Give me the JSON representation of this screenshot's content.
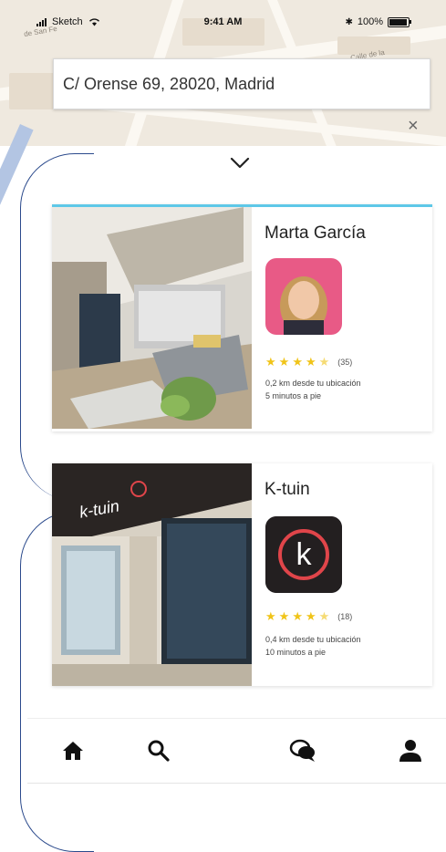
{
  "status_bar": {
    "carrier": "Sketch",
    "time": "9:41 AM",
    "battery": "100%",
    "icons": [
      "signal-icon",
      "wifi-icon",
      "bluetooth-icon",
      "battery-icon"
    ]
  },
  "map": {
    "street_labels": [
      "de San Fe",
      "Calle de la"
    ]
  },
  "search": {
    "address": "C/ Orense 69, 28020, Madrid",
    "clear_icon": "close-icon"
  },
  "panel": {
    "toggle_icon": "chevron-down-icon"
  },
  "results": [
    {
      "name": "Marta García",
      "rating": 4.5,
      "reviews": "(35)",
      "distance": "0,2 km desde tu ubicación",
      "walk": "5 minutos a pie"
    },
    {
      "name": "K-tuin",
      "logo_letter": "k",
      "store_sign": "k-tuin",
      "rating": 4.5,
      "reviews": "(18)",
      "distance": "0,4 km desde tu ubicación",
      "walk": "10 minutos a pie"
    }
  ],
  "nav": {
    "items": [
      "home-icon",
      "search-icon",
      "chat-icon",
      "profile-icon"
    ]
  },
  "colors": {
    "accent": "#5ec8e8",
    "star": "#f0c419",
    "annotation": "#2b4a8c"
  }
}
